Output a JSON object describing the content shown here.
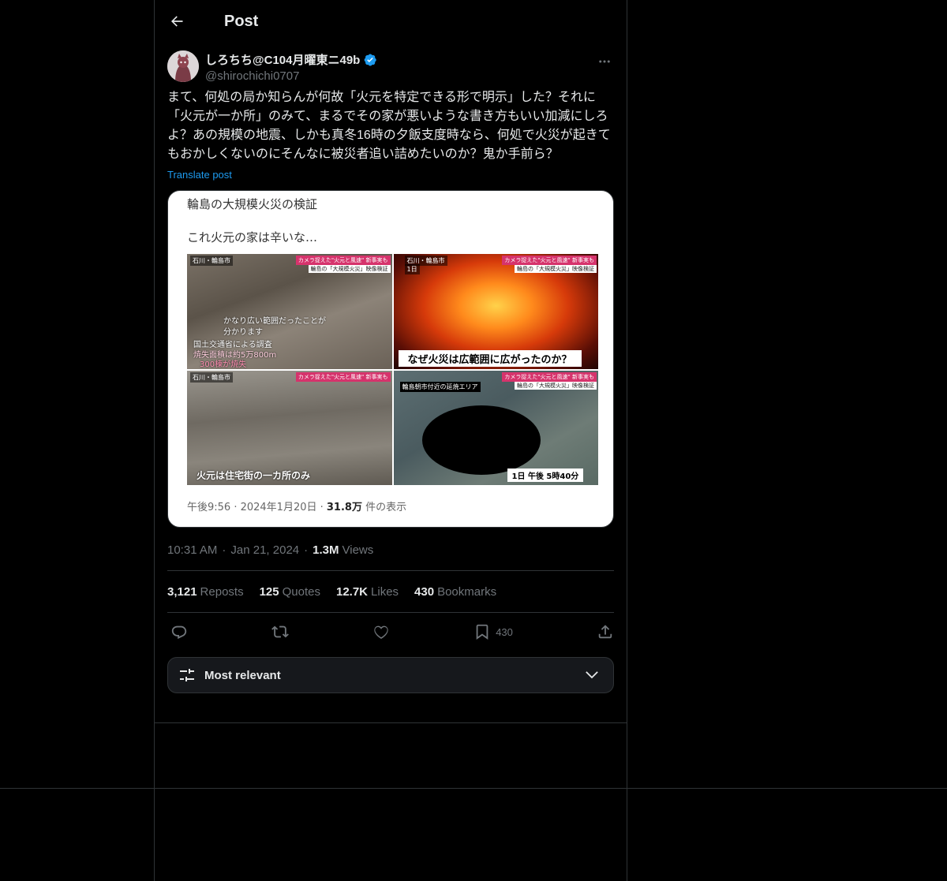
{
  "header": {
    "title": "Post"
  },
  "post": {
    "display_name": "しろちち@C104月曜東ニ49b",
    "handle": "@shirochichi0707",
    "text": "まて、何処の局か知らんが何故「火元を特定できる形で明示」した？それに「火元が一か所」のみて、まるでその家が悪いような書き方もいい加減にしろよ？あの規模の地震、しかも真冬16時の夕飯支度時なら、何処で火災が起きてもおかしくないのにそんなに被災者追い詰めたいのか？鬼か手前ら？",
    "translate_label": "Translate post",
    "time": "10:31 AM",
    "date": "Jan 21, 2024",
    "views_count": "1.3M",
    "views_label": "Views"
  },
  "media": {
    "line1": "輪島の大規模火災の検証",
    "line2": "これ火元の家は辛いな…",
    "panel1": {
      "location": "石川・輪島市",
      "badge": "カメラ捉えた\"火元と風速\" 新事実も",
      "sub": "輪島の「大規模火災」映像検証",
      "caption1": "かなり広い範囲だったことが",
      "caption2": "分かります",
      "caption3": "国土交通省による調査",
      "caption4": "焼失面積は約5万800m",
      "caption5": "300棟が焼失"
    },
    "panel2": {
      "location": "石川・輪島市",
      "day": "1日",
      "badge": "カメラ捉えた\"火元と風速\" 新事実も",
      "sub": "輪島の「大規模火災」映像検証",
      "caption": "なぜ火災は広範囲に広がったのか？"
    },
    "panel3": {
      "location": "石川・輪島市",
      "badge": "カメラ捉えた\"火元と風速\" 新事実も",
      "caption": "火元は住宅街の一カ所のみ"
    },
    "panel4": {
      "location": "輪島朝市付近の延焼エリア",
      "badge": "カメラ捉えた\"火元と風速\" 新事実も",
      "sub": "輪島の「大規模火災」映像検証",
      "caption": "1日 午後 5時40分"
    },
    "footer_time": "午後9:56 · 2024年1月20日 · ",
    "footer_views": "31.8万",
    "footer_views_label": " 件の表示"
  },
  "stats": {
    "reposts_count": "3,121",
    "reposts_label": "Reposts",
    "quotes_count": "125",
    "quotes_label": "Quotes",
    "likes_count": "12.7K",
    "likes_label": "Likes",
    "bookmarks_count": "430",
    "bookmarks_label": "Bookmarks"
  },
  "actions": {
    "bookmark_count": "430"
  },
  "sort": {
    "label": "Most relevant"
  },
  "colors": {
    "accent": "#1d9bf0",
    "background": "#000000",
    "border": "#2f3336",
    "muted": "#71767b"
  }
}
